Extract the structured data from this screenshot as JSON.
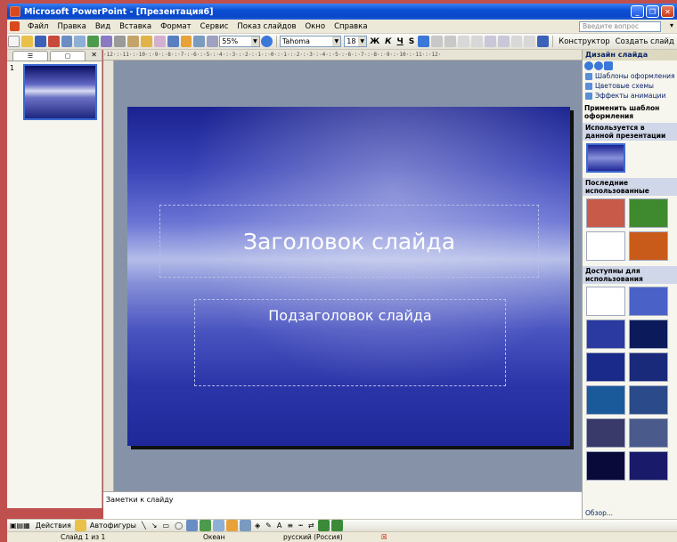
{
  "window": {
    "title": "Microsoft PowerPoint - [Презентация6]"
  },
  "menu": {
    "items": [
      "Файл",
      "Правка",
      "Вид",
      "Вставка",
      "Формат",
      "Сервис",
      "Показ слайдов",
      "Окно",
      "Справка"
    ],
    "ask_placeholder": "Введите вопрос"
  },
  "toolbar": {
    "zoom": "55%",
    "font": "Tahoma",
    "size": "18",
    "bold": "Ж",
    "italic": "К",
    "underline": "Ч",
    "shadow": "S",
    "designer_label": "Конструктор",
    "new_slide_label": "Создать слайд"
  },
  "left_panel": {
    "slide_number": "1"
  },
  "ruler": {
    "h": "·12·:·11·:·10·:·9·:·8·:·7·:·6·:·5·:·4·:·3·:·2·:·1·:·0·:·1·:·2·:·3·:·4·:·5·:·6·:·7·:·8·:·9·:·10·:·11·:·12·"
  },
  "slide": {
    "title": "Заголовок слайда",
    "subtitle": "Подзаголовок слайда"
  },
  "notes": {
    "placeholder": "Заметки к слайду"
  },
  "task_pane": {
    "title": "Дизайн слайда",
    "links": [
      "Шаблоны оформления",
      "Цветовые схемы",
      "Эффекты анимации"
    ],
    "apply_label": "Применить шаблон оформления",
    "in_use": "Используется в данной презентации",
    "recent": "Последние использованные",
    "available": "Доступны для использования",
    "browse": "Обзор..."
  },
  "draw_toolbar": {
    "actions": "Действия",
    "autoshapes": "Автофигуры"
  },
  "status": {
    "slide": "Слайд 1 из 1",
    "design": "Океан",
    "language": "русский (Россия)"
  }
}
